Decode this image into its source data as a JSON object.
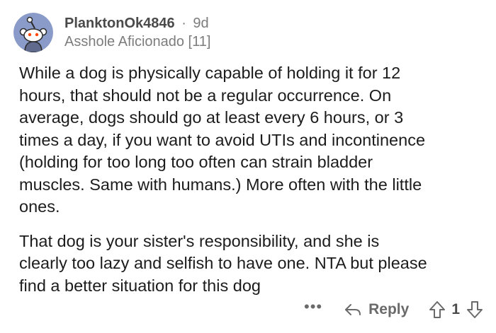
{
  "comment": {
    "author": "PlanktonOk4846",
    "separator": "·",
    "age": "9d",
    "flair": "Asshole Aficionado [11]",
    "paragraphs": [
      "While a dog is physically capable of holding it for 12\nhours, that should not be a regular occurrence. On\naverage, dogs should go at least every 6 hours, or 3\ntimes a day, if you want to avoid UTIs and incontinence\n(holding for too long too often can strain bladder\nmuscles. Same with humans.) More often with the little\nones.",
      "That dog is your sister's responsibility, and she is\nclearly too lazy and selfish to have one. NTA but please\nfind a better situation for this dog"
    ]
  },
  "actions": {
    "more_label": "•••",
    "reply_label": "Reply",
    "score": "1"
  },
  "icons": {
    "avatar": "snoo-avatar-icon",
    "reply": "reply-arrow-icon",
    "upvote": "upvote-arrow-icon",
    "downvote": "downvote-arrow-icon"
  },
  "colors": {
    "avatar_bg": "#8a9bc9",
    "text": "#1c1c1c",
    "meta": "#7c7c7c"
  }
}
